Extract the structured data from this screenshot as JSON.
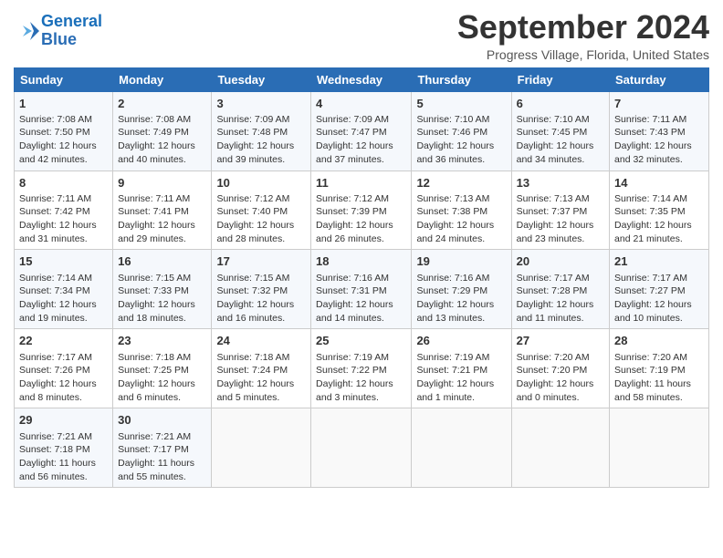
{
  "header": {
    "logo_line1": "General",
    "logo_line2": "Blue",
    "month": "September 2024",
    "location": "Progress Village, Florida, United States"
  },
  "days_of_week": [
    "Sunday",
    "Monday",
    "Tuesday",
    "Wednesday",
    "Thursday",
    "Friday",
    "Saturday"
  ],
  "weeks": [
    [
      {
        "day": "1",
        "info": "Sunrise: 7:08 AM\nSunset: 7:50 PM\nDaylight: 12 hours\nand 42 minutes."
      },
      {
        "day": "2",
        "info": "Sunrise: 7:08 AM\nSunset: 7:49 PM\nDaylight: 12 hours\nand 40 minutes."
      },
      {
        "day": "3",
        "info": "Sunrise: 7:09 AM\nSunset: 7:48 PM\nDaylight: 12 hours\nand 39 minutes."
      },
      {
        "day": "4",
        "info": "Sunrise: 7:09 AM\nSunset: 7:47 PM\nDaylight: 12 hours\nand 37 minutes."
      },
      {
        "day": "5",
        "info": "Sunrise: 7:10 AM\nSunset: 7:46 PM\nDaylight: 12 hours\nand 36 minutes."
      },
      {
        "day": "6",
        "info": "Sunrise: 7:10 AM\nSunset: 7:45 PM\nDaylight: 12 hours\nand 34 minutes."
      },
      {
        "day": "7",
        "info": "Sunrise: 7:11 AM\nSunset: 7:43 PM\nDaylight: 12 hours\nand 32 minutes."
      }
    ],
    [
      {
        "day": "8",
        "info": "Sunrise: 7:11 AM\nSunset: 7:42 PM\nDaylight: 12 hours\nand 31 minutes."
      },
      {
        "day": "9",
        "info": "Sunrise: 7:11 AM\nSunset: 7:41 PM\nDaylight: 12 hours\nand 29 minutes."
      },
      {
        "day": "10",
        "info": "Sunrise: 7:12 AM\nSunset: 7:40 PM\nDaylight: 12 hours\nand 28 minutes."
      },
      {
        "day": "11",
        "info": "Sunrise: 7:12 AM\nSunset: 7:39 PM\nDaylight: 12 hours\nand 26 minutes."
      },
      {
        "day": "12",
        "info": "Sunrise: 7:13 AM\nSunset: 7:38 PM\nDaylight: 12 hours\nand 24 minutes."
      },
      {
        "day": "13",
        "info": "Sunrise: 7:13 AM\nSunset: 7:37 PM\nDaylight: 12 hours\nand 23 minutes."
      },
      {
        "day": "14",
        "info": "Sunrise: 7:14 AM\nSunset: 7:35 PM\nDaylight: 12 hours\nand 21 minutes."
      }
    ],
    [
      {
        "day": "15",
        "info": "Sunrise: 7:14 AM\nSunset: 7:34 PM\nDaylight: 12 hours\nand 19 minutes."
      },
      {
        "day": "16",
        "info": "Sunrise: 7:15 AM\nSunset: 7:33 PM\nDaylight: 12 hours\nand 18 minutes."
      },
      {
        "day": "17",
        "info": "Sunrise: 7:15 AM\nSunset: 7:32 PM\nDaylight: 12 hours\nand 16 minutes."
      },
      {
        "day": "18",
        "info": "Sunrise: 7:16 AM\nSunset: 7:31 PM\nDaylight: 12 hours\nand 14 minutes."
      },
      {
        "day": "19",
        "info": "Sunrise: 7:16 AM\nSunset: 7:29 PM\nDaylight: 12 hours\nand 13 minutes."
      },
      {
        "day": "20",
        "info": "Sunrise: 7:17 AM\nSunset: 7:28 PM\nDaylight: 12 hours\nand 11 minutes."
      },
      {
        "day": "21",
        "info": "Sunrise: 7:17 AM\nSunset: 7:27 PM\nDaylight: 12 hours\nand 10 minutes."
      }
    ],
    [
      {
        "day": "22",
        "info": "Sunrise: 7:17 AM\nSunset: 7:26 PM\nDaylight: 12 hours\nand 8 minutes."
      },
      {
        "day": "23",
        "info": "Sunrise: 7:18 AM\nSunset: 7:25 PM\nDaylight: 12 hours\nand 6 minutes."
      },
      {
        "day": "24",
        "info": "Sunrise: 7:18 AM\nSunset: 7:24 PM\nDaylight: 12 hours\nand 5 minutes."
      },
      {
        "day": "25",
        "info": "Sunrise: 7:19 AM\nSunset: 7:22 PM\nDaylight: 12 hours\nand 3 minutes."
      },
      {
        "day": "26",
        "info": "Sunrise: 7:19 AM\nSunset: 7:21 PM\nDaylight: 12 hours\nand 1 minute."
      },
      {
        "day": "27",
        "info": "Sunrise: 7:20 AM\nSunset: 7:20 PM\nDaylight: 12 hours\nand 0 minutes."
      },
      {
        "day": "28",
        "info": "Sunrise: 7:20 AM\nSunset: 7:19 PM\nDaylight: 11 hours\nand 58 minutes."
      }
    ],
    [
      {
        "day": "29",
        "info": "Sunrise: 7:21 AM\nSunset: 7:18 PM\nDaylight: 11 hours\nand 56 minutes."
      },
      {
        "day": "30",
        "info": "Sunrise: 7:21 AM\nSunset: 7:17 PM\nDaylight: 11 hours\nand 55 minutes."
      },
      {
        "day": "",
        "info": ""
      },
      {
        "day": "",
        "info": ""
      },
      {
        "day": "",
        "info": ""
      },
      {
        "day": "",
        "info": ""
      },
      {
        "day": "",
        "info": ""
      }
    ]
  ]
}
